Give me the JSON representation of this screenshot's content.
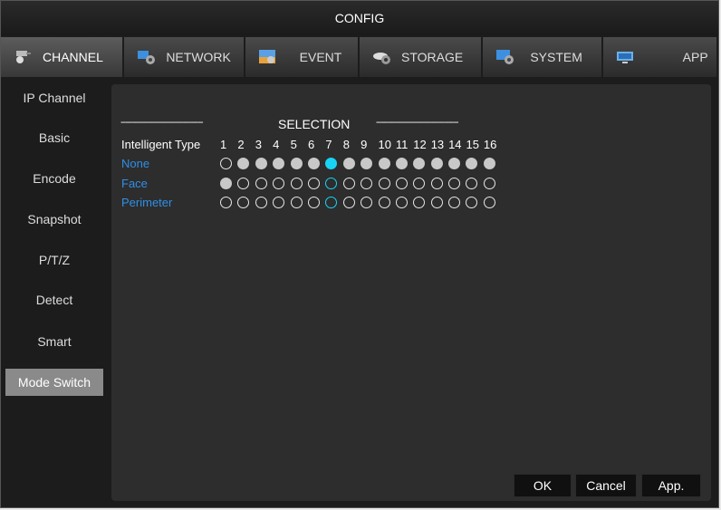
{
  "window": {
    "title": "CONFIG"
  },
  "tabs": [
    {
      "label": "CHANNEL",
      "icon": "channel-icon"
    },
    {
      "label": "NETWORK",
      "icon": "network-icon"
    },
    {
      "label": "EVENT",
      "icon": "event-icon"
    },
    {
      "label": "STORAGE",
      "icon": "storage-icon"
    },
    {
      "label": "SYSTEM",
      "icon": "system-icon"
    },
    {
      "label": "APP",
      "icon": "app-icon"
    }
  ],
  "sidebar": {
    "items": [
      {
        "label": "IP Channel"
      },
      {
        "label": "Basic"
      },
      {
        "label": "Encode"
      },
      {
        "label": "Snapshot"
      },
      {
        "label": "P/T/Z"
      },
      {
        "label": "Detect"
      },
      {
        "label": "Smart"
      },
      {
        "label": "Mode Switch"
      }
    ],
    "active_index": 7
  },
  "selection": {
    "left_rule": "----------------------------------",
    "heading": "SELECTION",
    "right_rule": "----------------------------------",
    "type_label": "Intelligent Type",
    "channels": [
      "1",
      "2",
      "3",
      "4",
      "5",
      "6",
      "7",
      "8",
      "9",
      "10",
      "11",
      "12",
      "13",
      "14",
      "15",
      "16"
    ],
    "selected_channel": 7,
    "modes": [
      {
        "label": "None",
        "filled": [
          false,
          true,
          true,
          true,
          true,
          true,
          true,
          true,
          true,
          true,
          true,
          true,
          true,
          true,
          true,
          true
        ]
      },
      {
        "label": "Face",
        "filled": [
          true,
          false,
          false,
          false,
          false,
          false,
          false,
          false,
          false,
          false,
          false,
          false,
          false,
          false,
          false,
          false
        ]
      },
      {
        "label": "Perimeter",
        "filled": [
          false,
          false,
          false,
          false,
          false,
          false,
          false,
          false,
          false,
          false,
          false,
          false,
          false,
          false,
          false,
          false
        ]
      }
    ]
  },
  "buttons": {
    "ok": "OK",
    "cancel": "Cancel",
    "apply": "App."
  },
  "colors": {
    "accent": "#19d3f5",
    "mode_label": "#2f8fe8",
    "active_side": "#8a8a8a"
  }
}
